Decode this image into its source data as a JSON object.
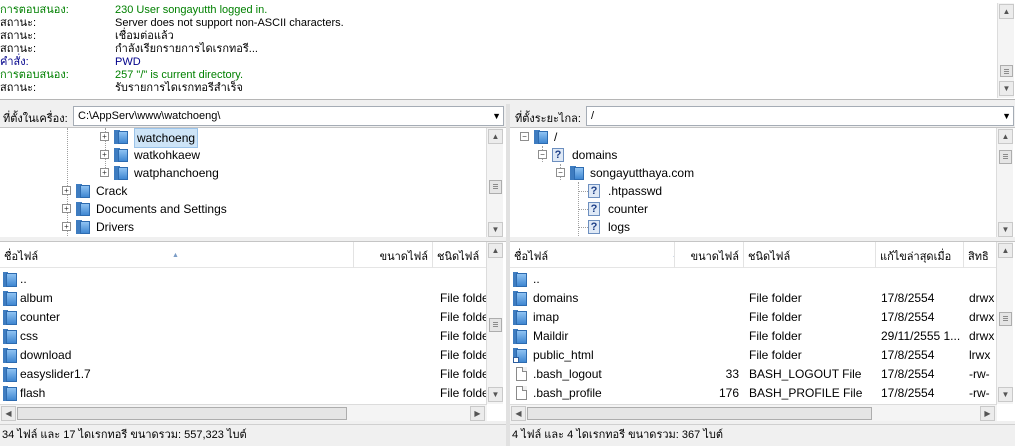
{
  "log": [
    {
      "key": "การตอบสนอง:",
      "value": "230 User songayutth logged in.",
      "color": "#008000"
    },
    {
      "key": "สถานะ:",
      "value": "Server does not support non-ASCII characters.",
      "color": "#000000"
    },
    {
      "key": "สถานะ:",
      "value": "เชื่อมต่อแล้ว",
      "color": "#000000"
    },
    {
      "key": "สถานะ:",
      "value": "กำลังเรียกรายการไดเรกทอรี...",
      "color": "#000000"
    },
    {
      "key": "คำสั่ง:",
      "value": "PWD",
      "color": "#00008b"
    },
    {
      "key": "การตอบสนอง:",
      "value": "257 \"/\" is current directory.",
      "color": "#008000"
    },
    {
      "key": "สถานะ:",
      "value": "รับรายการไดเรกทอรีสำเร็จ",
      "color": "#000000"
    }
  ],
  "local": {
    "path_label": "ที่ตั้งในเครื่อง:",
    "path": "C:\\AppServ\\www\\watchoeng\\",
    "tree": [
      {
        "label": "watchoeng",
        "expander": "+"
      },
      {
        "label": "watkohkaew",
        "expander": "+"
      },
      {
        "label": "watphanchoeng",
        "expander": "+"
      },
      {
        "label": "Crack",
        "expander": "+"
      },
      {
        "label": "Documents and Settings",
        "expander": "+"
      },
      {
        "label": "Drivers",
        "expander": "+"
      }
    ],
    "columns": {
      "name": "ชื่อไฟล์",
      "size": "ขนาดไฟล์",
      "type": "ชนิดไฟล์"
    },
    "files": [
      {
        "name": "..",
        "size": "",
        "type": "",
        "icon": "folder-icon"
      },
      {
        "name": "album",
        "size": "",
        "type": "File folde",
        "icon": "folder-icon"
      },
      {
        "name": "counter",
        "size": "",
        "type": "File folde",
        "icon": "folder-icon"
      },
      {
        "name": "css",
        "size": "",
        "type": "File folde",
        "icon": "folder-icon"
      },
      {
        "name": "download",
        "size": "",
        "type": "File folde",
        "icon": "folder-icon"
      },
      {
        "name": "easyslider1.7",
        "size": "",
        "type": "File folde",
        "icon": "folder-icon"
      },
      {
        "name": "flash",
        "size": "",
        "type": "File folde",
        "icon": "folder-icon"
      }
    ],
    "status": "34 ไฟล์ และ 17 ไดเรกทอรี ขนาดรวม: 557,323 ไบต์"
  },
  "remote": {
    "path_label": "ที่ตั้งระยะไกล:",
    "path": "/",
    "tree": [
      {
        "label": "/",
        "expander": "−",
        "icon": "folder-icon"
      },
      {
        "label": "domains",
        "expander": "−",
        "icon": "unknown-folder-icon"
      },
      {
        "label": "songayutthaya.com",
        "expander": "−",
        "icon": "folder-icon"
      },
      {
        "label": ".htpasswd",
        "expander": "",
        "icon": "unknown-folder-icon"
      },
      {
        "label": "counter",
        "expander": "",
        "icon": "unknown-folder-icon"
      },
      {
        "label": "logs",
        "expander": "",
        "icon": "unknown-folder-icon"
      }
    ],
    "columns": {
      "name": "ชื่อไฟล์",
      "size": "ขนาดไฟล์",
      "type": "ชนิดไฟล์",
      "modified": "แก้ไขล่าสุดเมื่อ",
      "perm": "สิทธิ"
    },
    "files": [
      {
        "name": "..",
        "size": "",
        "type": "",
        "modified": "",
        "perm": "",
        "icon": "folder-icon"
      },
      {
        "name": "domains",
        "size": "",
        "type": "File folder",
        "modified": "17/8/2554",
        "perm": "drwx",
        "icon": "folder-icon"
      },
      {
        "name": "imap",
        "size": "",
        "type": "File folder",
        "modified": "17/8/2554",
        "perm": "drwx",
        "icon": "folder-icon"
      },
      {
        "name": "Maildir",
        "size": "",
        "type": "File folder",
        "modified": "29/11/2555 1...",
        "perm": "drwx",
        "icon": "folder-icon"
      },
      {
        "name": "public_html",
        "size": "",
        "type": "File folder",
        "modified": "17/8/2554",
        "perm": "lrwx",
        "icon": "folder-shortcut-icon"
      },
      {
        "name": ".bash_logout",
        "size": "33",
        "type": "BASH_LOGOUT File",
        "modified": "17/8/2554",
        "perm": "-rw-",
        "icon": "file-icon"
      },
      {
        "name": ".bash_profile",
        "size": "176",
        "type": "BASH_PROFILE File",
        "modified": "17/8/2554",
        "perm": "-rw-",
        "icon": "file-icon"
      }
    ],
    "status": "4 ไฟล์ และ 4 ไดเรกทอรี ขนาดรวม: 367 ไบต์"
  }
}
